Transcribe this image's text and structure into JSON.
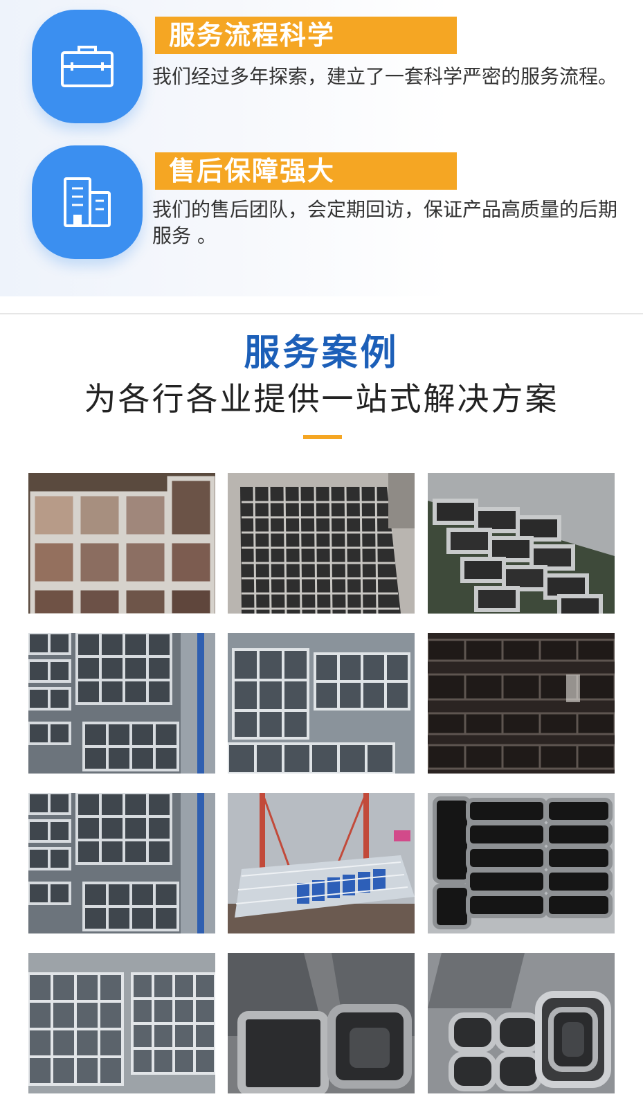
{
  "features": [
    {
      "title": "服务流程科学",
      "description": "我们经过多年探索，建立了一套科学严密的服务流程。",
      "icon": "briefcase-icon"
    },
    {
      "title": "售后保障强大",
      "description": "我们的售后团队，会定期回访，保证产品高质量的后期服务 。",
      "icon": "buildings-icon"
    }
  ],
  "service_cases": {
    "title": "服务案例",
    "subtitle": "为各行各业提供一站式解决方案"
  },
  "colors": {
    "accent": "#f5a623",
    "primary": "#1c5fb8",
    "icon_bg": "#3b8ff0"
  },
  "gallery": {
    "items": [
      {
        "subject": "steel-pipe-photo"
      },
      {
        "subject": "steel-pipe-photo"
      },
      {
        "subject": "steel-pipe-photo"
      },
      {
        "subject": "steel-pipe-photo"
      },
      {
        "subject": "steel-pipe-photo"
      },
      {
        "subject": "steel-pipe-photo"
      },
      {
        "subject": "steel-pipe-photo"
      },
      {
        "subject": "steel-pipe-photo"
      },
      {
        "subject": "steel-pipe-photo"
      },
      {
        "subject": "steel-pipe-photo"
      },
      {
        "subject": "steel-pipe-photo"
      },
      {
        "subject": "steel-pipe-photo"
      }
    ]
  }
}
